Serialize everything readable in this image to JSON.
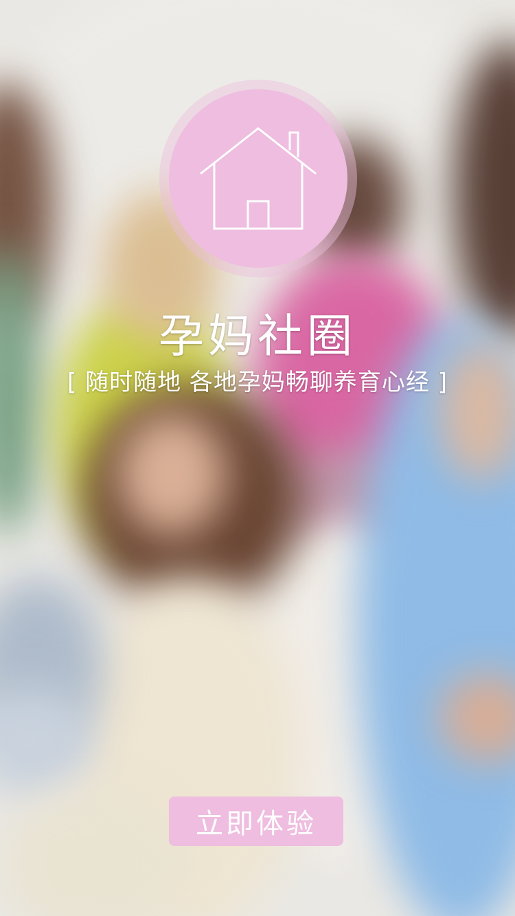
{
  "app": {
    "title": "孕妈社圈",
    "subtitle": "[ 随时随地 各地孕妈畅聊养育心经 ]"
  },
  "logo": {
    "icon": "house-icon",
    "color": "#eebddf"
  },
  "cta": {
    "label": "立即体验",
    "color": "#eebddf"
  },
  "background": {
    "description_icon": "blurred-photo-background"
  }
}
